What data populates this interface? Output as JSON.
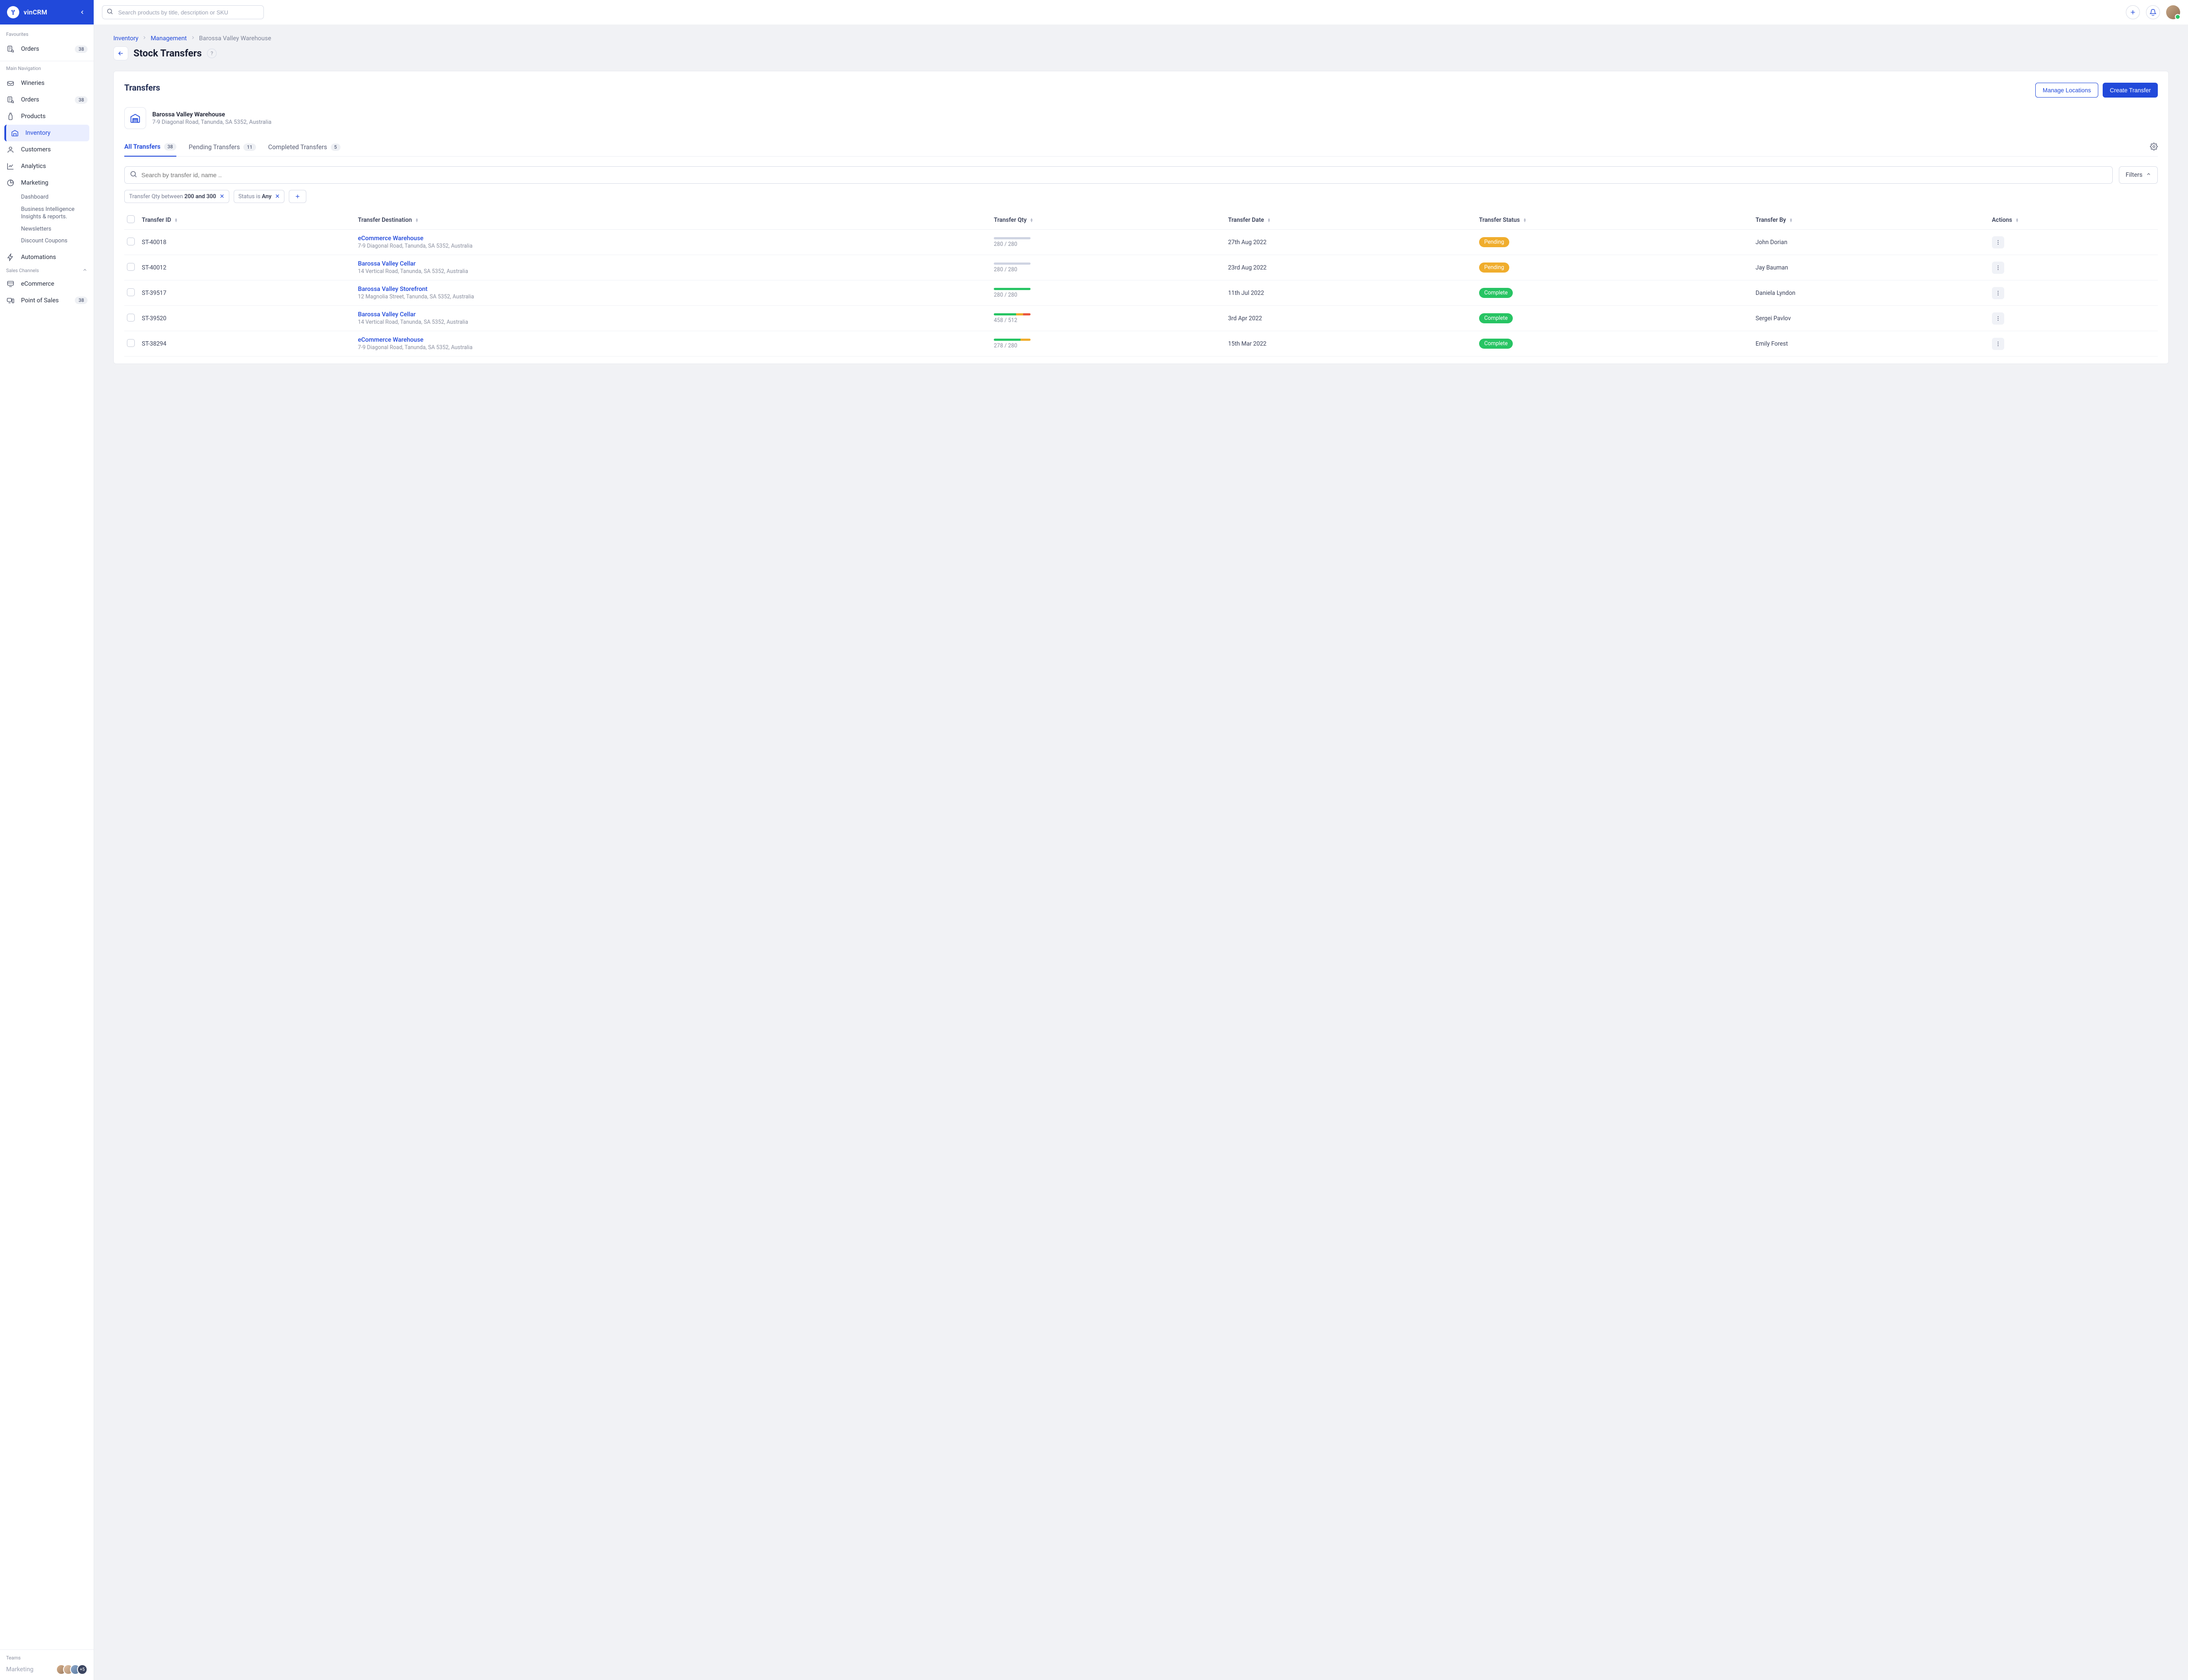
{
  "app": {
    "name": "vinCRM"
  },
  "topbar": {
    "search_placeholder": "Search products by title, description or SKU"
  },
  "sidebar": {
    "sections": {
      "favourites_label": "Favourites",
      "main_nav_label": "Main Navigation",
      "sales_channels_label": "Sales Channels",
      "teams_label": "Teams"
    },
    "favourites": [
      {
        "id": "orders",
        "label": "Orders",
        "badge": "38"
      }
    ],
    "main": [
      {
        "id": "wineries",
        "label": "Wineries"
      },
      {
        "id": "orders",
        "label": "Orders",
        "badge": "38"
      },
      {
        "id": "products",
        "label": "Products"
      },
      {
        "id": "inventory",
        "label": "Inventory",
        "active": true
      },
      {
        "id": "customers",
        "label": "Customers"
      },
      {
        "id": "analytics",
        "label": "Analytics"
      },
      {
        "id": "marketing",
        "label": "Marketing",
        "children": [
          "Dashboard",
          "Business Intelligence Insights & reports.",
          "Newsletters",
          "Discount Coupons"
        ]
      },
      {
        "id": "automations",
        "label": "Automations"
      }
    ],
    "channels": [
      {
        "id": "ecommerce",
        "label": "eCommerce"
      },
      {
        "id": "pos",
        "label": "Point of Sales",
        "badge": "38"
      }
    ],
    "team": {
      "name": "Marketing",
      "more": "+5"
    }
  },
  "breadcrumbs": [
    {
      "label": "Inventory",
      "link": true
    },
    {
      "label": "Management",
      "link": true
    },
    {
      "label": "Barossa Valley Warehouse",
      "link": false
    }
  ],
  "page": {
    "title": "Stock Transfers",
    "help": "?"
  },
  "panel": {
    "title": "Transfers",
    "manage_btn": "Manage  Locations",
    "create_btn": "Create Transfer",
    "warehouse": {
      "name": "Barossa Valley Warehouse",
      "address": "7-9 Diagonal Road, Tanunda, SA 5352, Australia"
    },
    "tabs": [
      {
        "label": "All Transfers",
        "badge": "38",
        "active": true
      },
      {
        "label": "Pending Transfers",
        "badge": "11"
      },
      {
        "label": "Completed Transfers",
        "badge": "5"
      }
    ],
    "search_placeholder": "Search by transfer id, name ..",
    "filters_label": "Filters",
    "chips": [
      {
        "prefix": "Transfer Qty between ",
        "bold": "200 and 300"
      },
      {
        "prefix": "Status is ",
        "bold": "Any"
      }
    ],
    "columns": [
      "Transfer ID",
      "Transfer Destination",
      "Transfer Qty",
      "Transfer Date",
      "Transfer Status",
      "Transfer By",
      "Actions"
    ],
    "rows": [
      {
        "id": "ST-40018",
        "dest_name": "eCommerce Warehouse",
        "dest_addr": "7-9 Diagonal Road, Tanunda, SA 5352, Australia",
        "qty": "280 / 280",
        "segs": [
          {
            "c": "#cfd4e2",
            "w": 100
          }
        ],
        "date": "27th Aug 2022",
        "status": "Pending",
        "status_class": "status-pending",
        "by": "John Dorian"
      },
      {
        "id": "ST-40012",
        "dest_name": "Barossa Valley Cellar",
        "dest_addr": "14 Vertical Road, Tanunda, SA 5352, Australia",
        "qty": "280 / 280",
        "segs": [
          {
            "c": "#cfd4e2",
            "w": 100
          }
        ],
        "date": "23rd Aug 2022",
        "status": "Pending",
        "status_class": "status-pending",
        "by": "Jay Bauman"
      },
      {
        "id": "ST-39517",
        "dest_name": "Barossa Valley Storefront",
        "dest_addr": "12 Magnolia Street, Tanunda, SA 5352, Australia",
        "qty": "280 / 280",
        "segs": [
          {
            "c": "#27c463",
            "w": 100
          }
        ],
        "date": "11th Jul 2022",
        "status": "Complete",
        "status_class": "status-complete",
        "by": "Daniela Lyndon"
      },
      {
        "id": "ST-39520",
        "dest_name": "Barossa Valley Cellar",
        "dest_addr": "14 Vertical Road, Tanunda, SA 5352, Australia",
        "qty": "458 / 512",
        "segs": [
          {
            "c": "#27c463",
            "w": 60
          },
          {
            "c": "#f0ad2d",
            "w": 20
          },
          {
            "c": "#e9573f",
            "w": 20
          }
        ],
        "date": "3rd Apr 2022",
        "status": "Complete",
        "status_class": "status-complete",
        "by": "Sergei Pavlov"
      },
      {
        "id": "ST-38294",
        "dest_name": "eCommerce Warehouse",
        "dest_addr": "7-9 Diagonal Road, Tanunda, SA 5352, Australia",
        "qty": "278 / 280",
        "segs": [
          {
            "c": "#27c463",
            "w": 72
          },
          {
            "c": "#f0ad2d",
            "w": 28
          }
        ],
        "date": "15th Mar 2022",
        "status": "Complete",
        "status_class": "status-complete",
        "by": "Emily Forest"
      }
    ]
  },
  "colors": {
    "primary": "#2149da",
    "pending": "#f0ad2d",
    "complete": "#27c463"
  }
}
